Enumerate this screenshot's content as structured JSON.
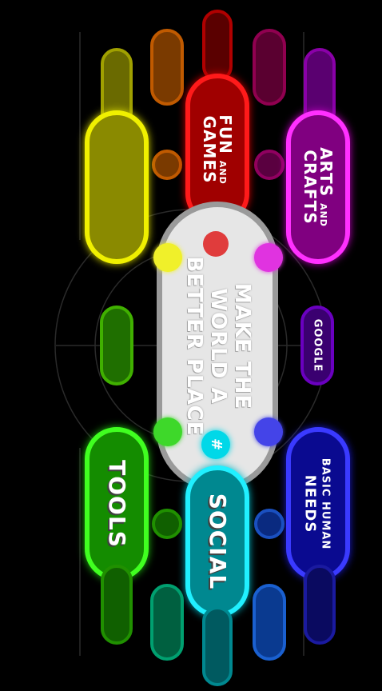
{
  "center": {
    "line1": "MAKE THE",
    "line2": "WORLD A",
    "line3": "BETTER PLACE"
  },
  "categories": {
    "fun_games": {
      "line1": "FUN",
      "and": "AND",
      "line2": "GAMES"
    },
    "arts_crafts": {
      "line1": "ARTS",
      "and": "AND",
      "line2": "CRAFTS"
    },
    "google": "GOOGLE",
    "tools": "TOOLS",
    "social": "SOCIAL",
    "social_hash": "#",
    "basic_needs": {
      "line1": "BASIC HUMAN",
      "line2": "NEEDS"
    }
  },
  "colors": {
    "red": "#d00000",
    "yellow": "#d6d600",
    "magenta": "#c000c0",
    "green": "#20c010",
    "cyan": "#00b8c8",
    "blue": "#1a1ad0",
    "orange": "#c05a00",
    "purple": "#5a00a8",
    "center_fill": "#e6e6e6",
    "center_text": "#b0b0b0"
  }
}
